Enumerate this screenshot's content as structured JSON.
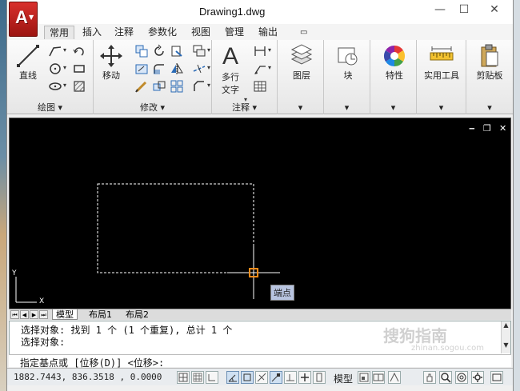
{
  "window": {
    "title": "Drawing1.dwg",
    "controls": {
      "minimize": "—",
      "maximize": "☐",
      "close": "✕"
    },
    "app_logo": "A"
  },
  "tabs": [
    {
      "label": "常用",
      "active": true
    },
    {
      "label": "插入"
    },
    {
      "label": "注释"
    },
    {
      "label": "参数化"
    },
    {
      "label": "视图"
    },
    {
      "label": "管理"
    },
    {
      "label": "输出"
    },
    {
      "label": "▭"
    }
  ],
  "ribbon": {
    "draw": {
      "label": "绘图 ▾",
      "line_label": "直线"
    },
    "modify": {
      "label": "修改 ▾",
      "move_label": "移动"
    },
    "annotation": {
      "label": "注释 ▾",
      "mtext_label": "多行\n文字",
      "mtext_line1": "多行",
      "mtext_line2": "文字"
    },
    "layers": {
      "label": "图层",
      "arrow": "▾"
    },
    "block": {
      "label": "块",
      "arrow": "▾"
    },
    "properties": {
      "label": "特性",
      "arrow": "▾"
    },
    "utilities": {
      "label": "实用工具",
      "arrow": "▾"
    },
    "clipboard": {
      "label": "剪贴板",
      "arrow": "▾"
    }
  },
  "canvas": {
    "drawing_controls": {
      "minimize": "‒",
      "restore": "❐",
      "close": "✕"
    },
    "tooltip": "端点",
    "ucs": {
      "x": "X",
      "y": "Y"
    }
  },
  "layout_tabs": [
    {
      "label": "模型",
      "active": true
    },
    {
      "label": "布局1"
    },
    {
      "label": "布局2"
    }
  ],
  "command": {
    "history": [
      "选择对象: 找到 1 个 (1 个重复), 总计 1 个",
      "选择对象:"
    ],
    "prompt": "指定基点或 [位移(D)] <位移>:"
  },
  "status": {
    "coordinates": "1882.7443, 836.3518 , 0.0000",
    "model_label": "模型"
  },
  "watermark": {
    "text": "搜狗指南",
    "sub": "zhinan.sogou.com"
  },
  "colors": {
    "accent_red": "#c62a24",
    "canvas_bg": "#000000",
    "osnap_marker": "#ff8c1a",
    "tooltip_bg": "#b8c4e0"
  }
}
